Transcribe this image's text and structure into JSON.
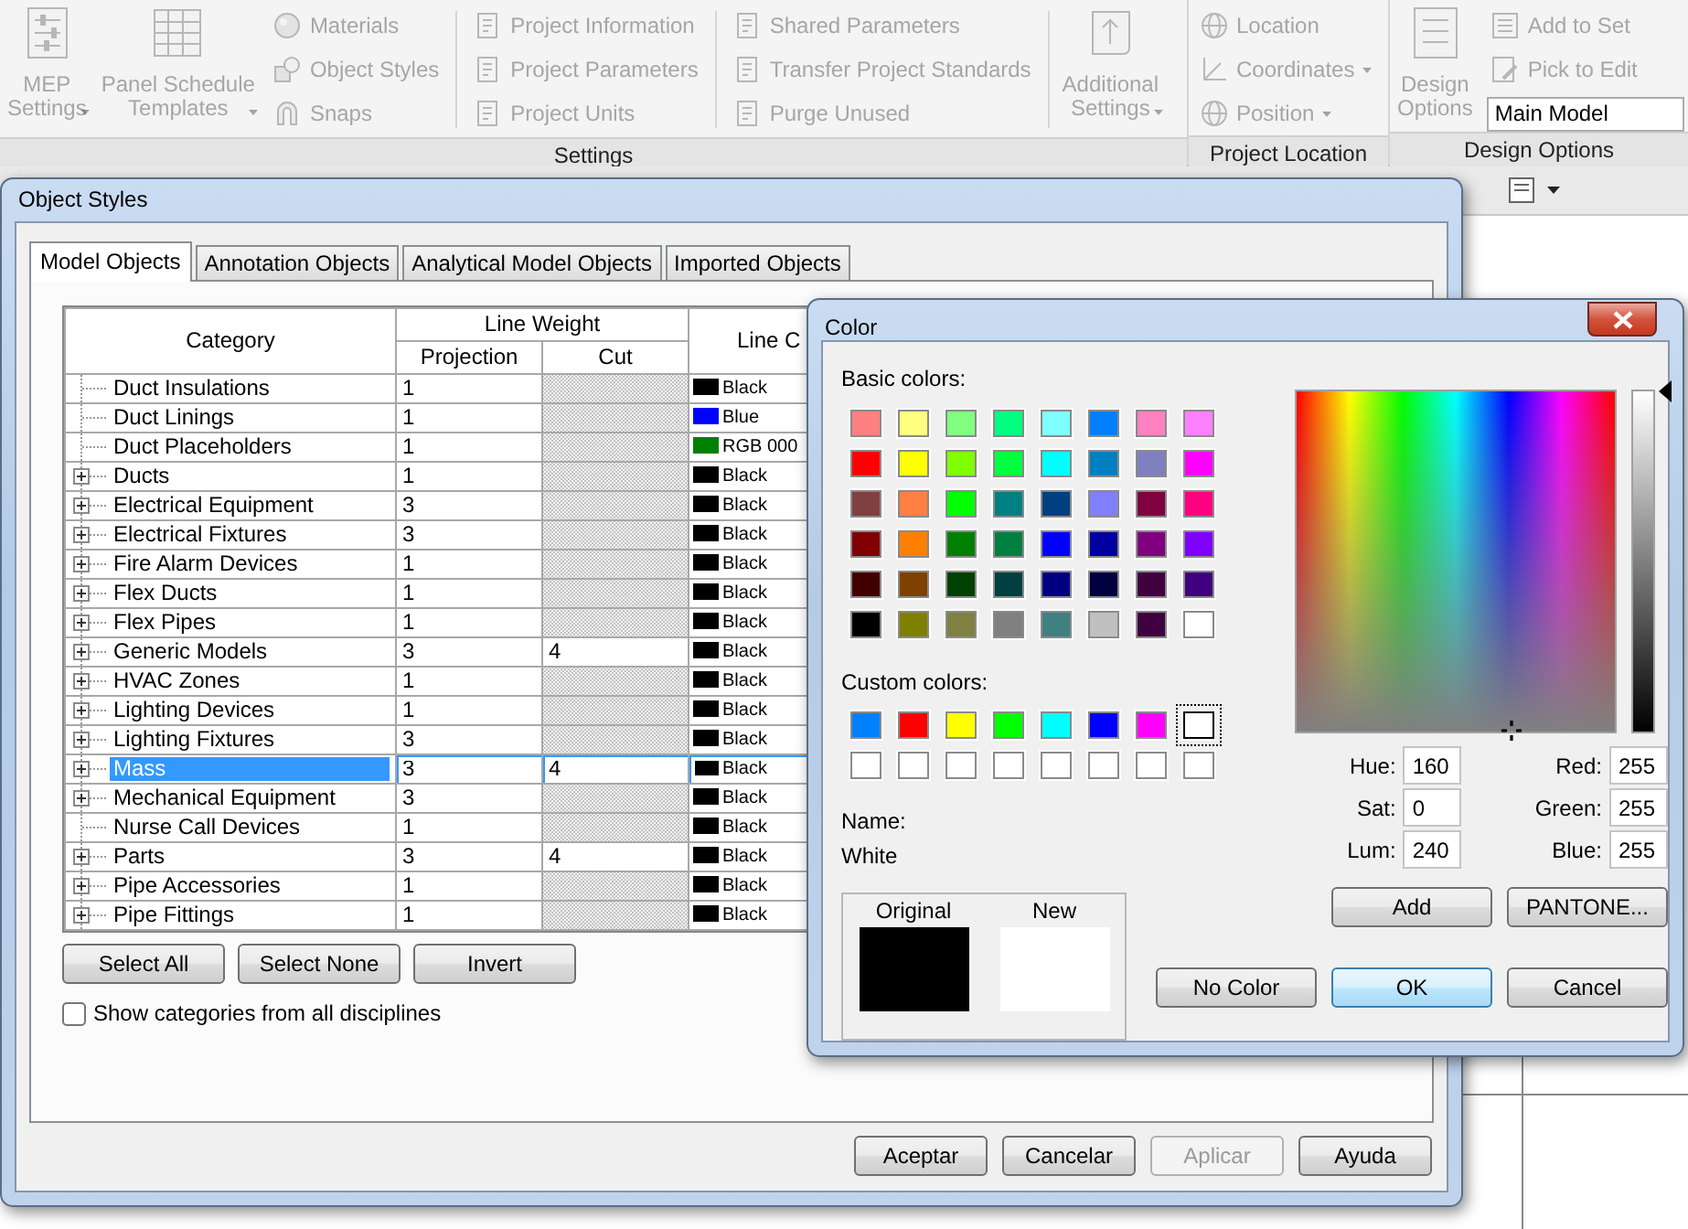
{
  "ribbon": {
    "panels": [
      {
        "title": "Settings",
        "columns": [
          {
            "kind": "large",
            "label_lines": [
              "MEP",
              "Settings"
            ],
            "dropdown": true,
            "disabled": true
          },
          {
            "kind": "large",
            "label_lines": [
              "Panel Schedule",
              "Templates"
            ],
            "dropdown": true,
            "disabled": true
          },
          {
            "kind": "stack",
            "items": [
              {
                "kind": "button",
                "label": "Materials",
                "dropdown": false,
                "disabled": true
              },
              {
                "kind": "button",
                "label": "Object Styles",
                "dropdown": false,
                "disabled": true
              },
              {
                "kind": "button",
                "label": "Snaps",
                "dropdown": false,
                "disabled": true
              }
            ]
          },
          {
            "kind": "stack",
            "items": [
              {
                "kind": "button",
                "label": "Project Information",
                "dropdown": false,
                "disabled": true
              },
              {
                "kind": "button",
                "label": "Project Parameters",
                "dropdown": false,
                "disabled": true
              },
              {
                "kind": "button",
                "label": "Project Units",
                "dropdown": false,
                "disabled": true
              }
            ]
          },
          {
            "kind": "stack",
            "items": [
              {
                "kind": "button",
                "label": "Shared Parameters",
                "dropdown": false,
                "disabled": true
              },
              {
                "kind": "button",
                "label": "Transfer Project Standards",
                "dropdown": false,
                "disabled": true
              },
              {
                "kind": "button",
                "label": "Purge Unused",
                "dropdown": false,
                "disabled": true
              }
            ]
          },
          {
            "kind": "large",
            "label_lines": [
              "Additional",
              "Settings"
            ],
            "dropdown": true,
            "disabled": true
          }
        ]
      },
      {
        "title": "Project Location",
        "columns": [
          {
            "kind": "stack",
            "items": [
              {
                "kind": "button",
                "label": "Location",
                "dropdown": false,
                "disabled": true
              },
              {
                "kind": "button",
                "label": "Coordinates",
                "dropdown": true,
                "disabled": true
              },
              {
                "kind": "button",
                "label": "Position",
                "dropdown": true,
                "disabled": true
              }
            ]
          }
        ]
      },
      {
        "title": "Design Options",
        "columns": [
          {
            "kind": "large",
            "label_lines": [
              "Design",
              "Options"
            ],
            "dropdown": false,
            "disabled": true
          },
          {
            "kind": "stack",
            "items": [
              {
                "kind": "button",
                "label": "Add to Set",
                "dropdown": false,
                "disabled": true
              },
              {
                "kind": "button",
                "label": "Pick to Edit",
                "dropdown": false,
                "disabled": true
              },
              {
                "kind": "combo",
                "value": "Main Model"
              }
            ]
          }
        ]
      }
    ]
  },
  "object_styles": {
    "title": "Object Styles",
    "tabs": [
      {
        "label": "Model Objects",
        "selected": true
      },
      {
        "label": "Annotation Objects",
        "selected": false
      },
      {
        "label": "Analytical Model Objects",
        "selected": false
      },
      {
        "label": "Imported Objects",
        "selected": false
      }
    ],
    "table": {
      "columns": {
        "category": "Category",
        "line_weight": "Line Weight",
        "projection": "Projection",
        "cut": "Cut",
        "column_4": "Line C"
      },
      "rows": [
        {
          "category": "Duct Insulations",
          "expandable": false,
          "projection": "1",
          "line_color": {
            "label": "Black",
            "color": "#000000"
          },
          "selected": false
        },
        {
          "category": "Duct Linings",
          "expandable": false,
          "projection": "1",
          "line_color": {
            "label": "Blue",
            "color": "#0000ff"
          },
          "selected": false
        },
        {
          "category": "Duct Placeholders",
          "expandable": false,
          "projection": "1",
          "line_color": {
            "label": "RGB 000",
            "color": "#008000"
          },
          "selected": false
        },
        {
          "category": "Ducts",
          "expandable": true,
          "projection": "1",
          "line_color": {
            "label": "Black",
            "color": "#000000"
          },
          "selected": false
        },
        {
          "category": "Electrical Equipment",
          "expandable": true,
          "projection": "3",
          "line_color": {
            "label": "Black",
            "color": "#000000"
          },
          "selected": false
        },
        {
          "category": "Electrical Fixtures",
          "expandable": true,
          "projection": "3",
          "line_color": {
            "label": "Black",
            "color": "#000000"
          },
          "selected": false
        },
        {
          "category": "Fire Alarm Devices",
          "expandable": true,
          "projection": "1",
          "line_color": {
            "label": "Black",
            "color": "#000000"
          },
          "selected": false
        },
        {
          "category": "Flex Ducts",
          "expandable": true,
          "projection": "1",
          "line_color": {
            "label": "Black",
            "color": "#000000"
          },
          "selected": false
        },
        {
          "category": "Flex Pipes",
          "expandable": true,
          "projection": "1",
          "line_color": {
            "label": "Black",
            "color": "#000000"
          },
          "selected": false
        },
        {
          "category": "Generic Models",
          "expandable": true,
          "projection": "3",
          "cut": "4",
          "line_color": {
            "label": "Black",
            "color": "#000000"
          },
          "selected": false
        },
        {
          "category": "HVAC Zones",
          "expandable": true,
          "projection": "1",
          "line_color": {
            "label": "Black",
            "color": "#000000"
          },
          "selected": false
        },
        {
          "category": "Lighting Devices",
          "expandable": true,
          "projection": "1",
          "line_color": {
            "label": "Black",
            "color": "#000000"
          },
          "selected": false
        },
        {
          "category": "Lighting Fixtures",
          "expandable": true,
          "projection": "3",
          "line_color": {
            "label": "Black",
            "color": "#000000"
          },
          "selected": false
        },
        {
          "category": "Mass",
          "expandable": true,
          "projection": "3",
          "cut": "4",
          "line_color": {
            "label": "Black",
            "color": "#000000"
          },
          "selected": true
        },
        {
          "category": "Mechanical Equipment",
          "expandable": true,
          "projection": "3",
          "line_color": {
            "label": "Black",
            "color": "#000000"
          },
          "selected": false
        },
        {
          "category": "Nurse Call Devices",
          "expandable": false,
          "projection": "1",
          "line_color": {
            "label": "Black",
            "color": "#000000"
          },
          "selected": false
        },
        {
          "category": "Parts",
          "expandable": true,
          "projection": "3",
          "cut": "4",
          "line_color": {
            "label": "Black",
            "color": "#000000"
          },
          "selected": false
        },
        {
          "category": "Pipe Accessories",
          "expandable": true,
          "projection": "1",
          "line_color": {
            "label": "Black",
            "color": "#000000"
          },
          "selected": false
        },
        {
          "category": "Pipe Fittings",
          "expandable": true,
          "projection": "1",
          "line_color": {
            "label": "Black",
            "color": "#000000"
          },
          "selected": false
        }
      ]
    },
    "selection_buttons": [
      "Select All",
      "Select None",
      "Invert"
    ],
    "show_all_disciplines": {
      "label": "Show categories from all disciplines",
      "checked": false
    },
    "buttons": [
      {
        "label": "Aceptar",
        "disabled": false
      },
      {
        "label": "Cancelar",
        "disabled": false
      },
      {
        "label": "Aplicar",
        "disabled": true
      },
      {
        "label": "Ayuda",
        "disabled": false
      }
    ]
  },
  "color_dialog": {
    "title": "Color",
    "basic_colors_label": "Basic colors:",
    "basic_colors": [
      {
        "color": "#ff8080",
        "selected": false
      },
      {
        "color": "#ffff80",
        "selected": false
      },
      {
        "color": "#80ff80",
        "selected": false
      },
      {
        "color": "#00ff80",
        "selected": false
      },
      {
        "color": "#80ffff",
        "selected": false
      },
      {
        "color": "#0080ff",
        "selected": false
      },
      {
        "color": "#ff80c0",
        "selected": false
      },
      {
        "color": "#ff80ff",
        "selected": false
      },
      {
        "color": "#ff0000",
        "selected": false
      },
      {
        "color": "#ffff00",
        "selected": false
      },
      {
        "color": "#80ff00",
        "selected": false
      },
      {
        "color": "#00ff40",
        "selected": false
      },
      {
        "color": "#00ffff",
        "selected": false
      },
      {
        "color": "#0080c0",
        "selected": false
      },
      {
        "color": "#8080c0",
        "selected": false
      },
      {
        "color": "#ff00ff",
        "selected": false
      },
      {
        "color": "#804040",
        "selected": false
      },
      {
        "color": "#ff8040",
        "selected": false
      },
      {
        "color": "#00ff00",
        "selected": false
      },
      {
        "color": "#008080",
        "selected": false
      },
      {
        "color": "#004080",
        "selected": false
      },
      {
        "color": "#8080ff",
        "selected": false
      },
      {
        "color": "#800040",
        "selected": false
      },
      {
        "color": "#ff0080",
        "selected": false
      },
      {
        "color": "#800000",
        "selected": false
      },
      {
        "color": "#ff8000",
        "selected": false
      },
      {
        "color": "#008000",
        "selected": false
      },
      {
        "color": "#008040",
        "selected": false
      },
      {
        "color": "#0000ff",
        "selected": false
      },
      {
        "color": "#0000a0",
        "selected": false
      },
      {
        "color": "#800080",
        "selected": false
      },
      {
        "color": "#8000ff",
        "selected": false
      },
      {
        "color": "#400000",
        "selected": false
      },
      {
        "color": "#804000",
        "selected": false
      },
      {
        "color": "#004000",
        "selected": false
      },
      {
        "color": "#004040",
        "selected": false
      },
      {
        "color": "#000080",
        "selected": false
      },
      {
        "color": "#000040",
        "selected": false
      },
      {
        "color": "#400040",
        "selected": false
      },
      {
        "color": "#400080",
        "selected": false
      },
      {
        "color": "#000000",
        "selected": false
      },
      {
        "color": "#808000",
        "selected": false
      },
      {
        "color": "#808040",
        "selected": false
      },
      {
        "color": "#808080",
        "selected": false
      },
      {
        "color": "#408080",
        "selected": false
      },
      {
        "color": "#c0c0c0",
        "selected": false
      },
      {
        "color": "#400040",
        "selected": false
      },
      {
        "color": "#ffffff",
        "selected": false
      }
    ],
    "custom_colors_label": "Custom colors:",
    "custom_colors": [
      {
        "color": "#0080ff",
        "selected": false
      },
      {
        "color": "#ff0000",
        "selected": false
      },
      {
        "color": "#ffff00",
        "selected": false
      },
      {
        "color": "#00ff00",
        "selected": false
      },
      {
        "color": "#00ffff",
        "selected": false
      },
      {
        "color": "#0000ff",
        "selected": false
      },
      {
        "color": "#ff00ff",
        "selected": false
      },
      {
        "color": "#ffffff",
        "selected": true
      },
      {
        "color": "#ffffff",
        "selected": false
      },
      {
        "color": "#ffffff",
        "selected": false
      },
      {
        "color": "#ffffff",
        "selected": false
      },
      {
        "color": "#ffffff",
        "selected": false
      },
      {
        "color": "#ffffff",
        "selected": false
      },
      {
        "color": "#ffffff",
        "selected": false
      },
      {
        "color": "#ffffff",
        "selected": false
      },
      {
        "color": "#ffffff",
        "selected": false
      }
    ],
    "name_label": "Name:",
    "name_value": "White",
    "preview": [
      {
        "label": "Original",
        "color": "#000000"
      },
      {
        "label": "New",
        "color": "#ffffff"
      }
    ],
    "luminance_slider": {
      "level": 1
    },
    "hsl_fields": [
      {
        "label": "Hue:",
        "value": "160"
      },
      {
        "label": "Sat:",
        "value": "0"
      },
      {
        "label": "Lum:",
        "value": "240"
      }
    ],
    "rgb_fields": [
      {
        "label": "Red:",
        "value": "255"
      },
      {
        "label": "Green:",
        "value": "255"
      },
      {
        "label": "Blue:",
        "value": "255"
      }
    ],
    "side_buttons": [
      "Add",
      "PANTONE..."
    ],
    "buttons": [
      {
        "label": "No Color",
        "default": false
      },
      {
        "label": "OK",
        "default": true
      },
      {
        "label": "Cancel",
        "default": false
      }
    ]
  }
}
